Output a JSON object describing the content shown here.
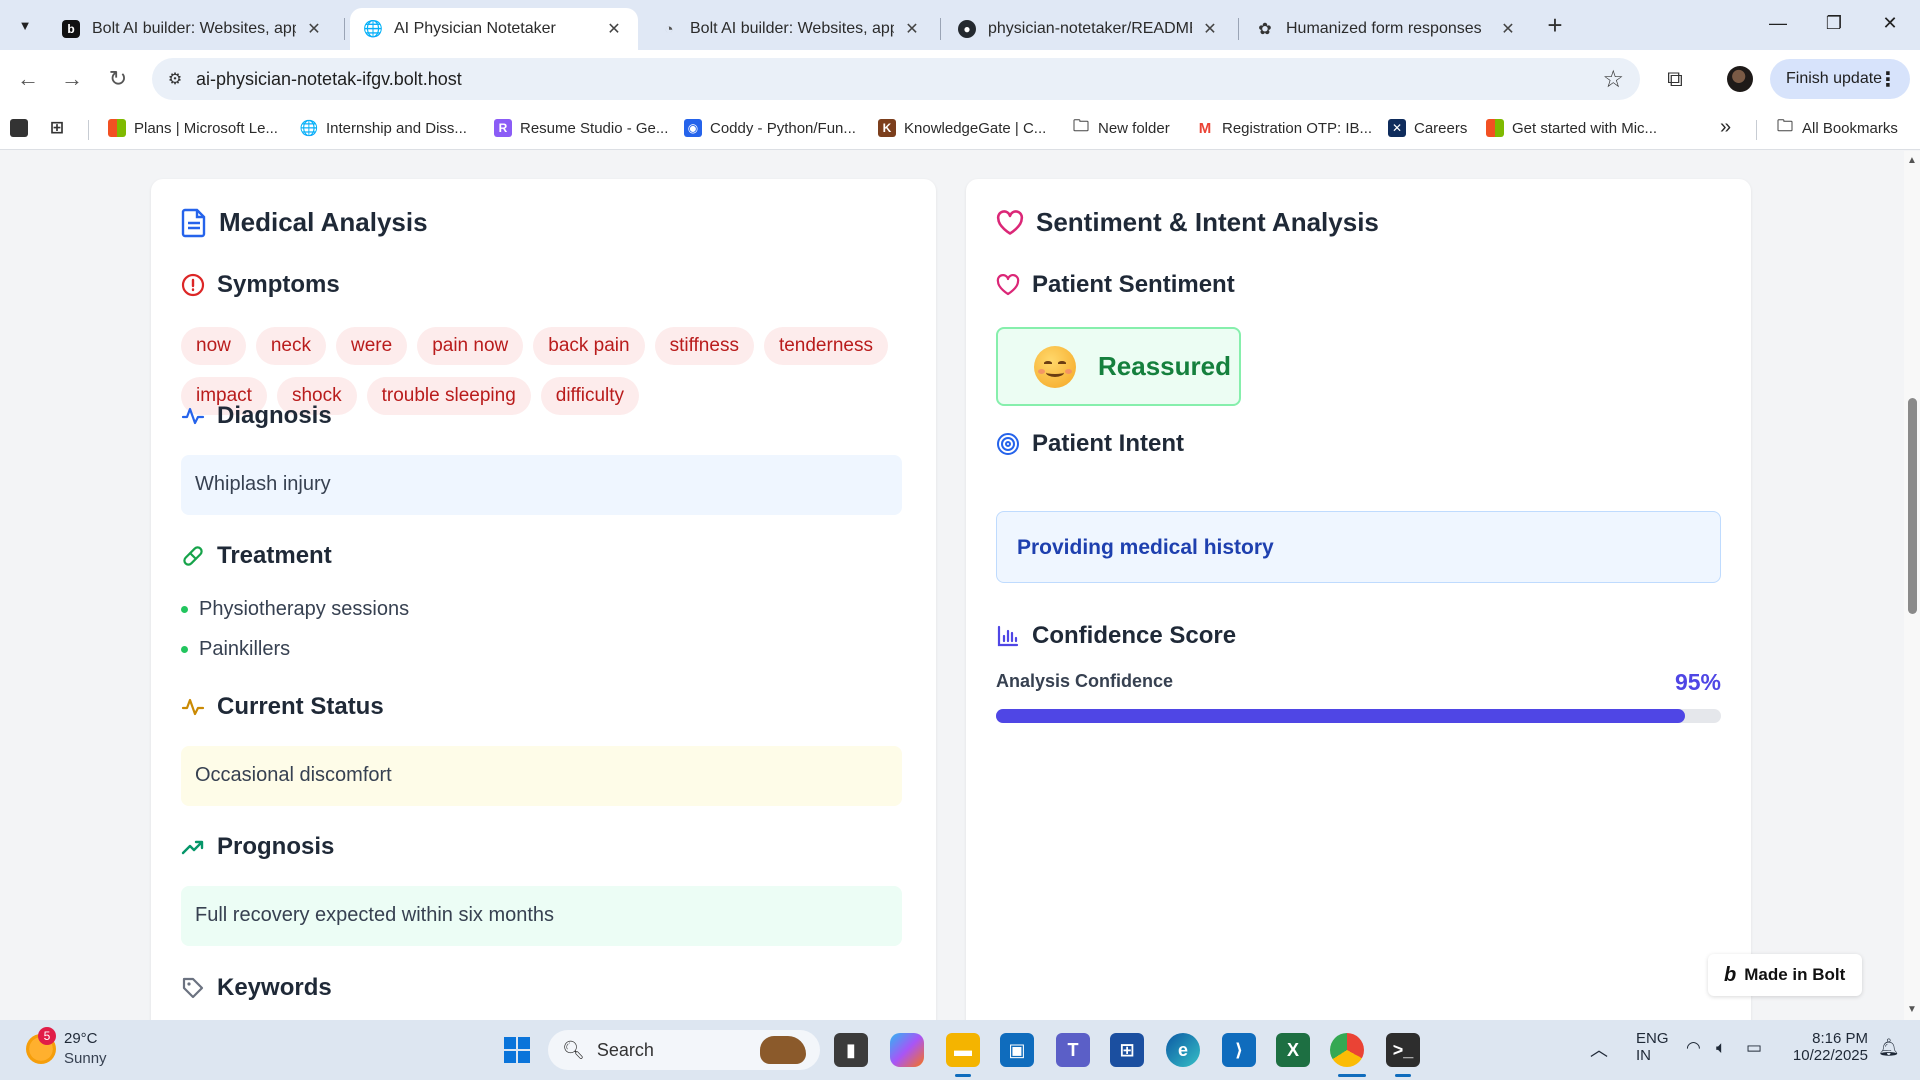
{
  "browser": {
    "tabs": [
      {
        "title": "Bolt AI builder: Websites, apps &",
        "active": false
      },
      {
        "title": "AI Physician Notetaker",
        "active": true
      },
      {
        "title": "Bolt AI builder: Websites, apps &",
        "active": false
      },
      {
        "title": "physician-notetaker/README.m",
        "active": false
      },
      {
        "title": "Humanized form responses",
        "active": false
      }
    ],
    "url": "ai-physician-notetak-ifgv.bolt.host",
    "finish_update_label": "Finish update",
    "bookmarks": [
      "Plans | Microsoft Le...",
      "Internship and Diss...",
      "Resume Studio - Ge...",
      "Coddy - Python/Fun...",
      "KnowledgeGate | C...",
      "New folder",
      "Registration OTP: IB...",
      "Careers",
      "Get started with Mic..."
    ],
    "all_bookmarks_label": "All Bookmarks",
    "more_bookmarks": "»"
  },
  "medical": {
    "title": "Medical Analysis",
    "symptoms_heading": "Symptoms",
    "symptoms": [
      "now",
      "neck",
      "were",
      "pain now",
      "back pain",
      "stiffness",
      "tenderness",
      "impact",
      "shock",
      "trouble sleeping",
      "difficulty"
    ],
    "diagnosis_heading": "Diagnosis",
    "diagnosis": "Whiplash injury",
    "treatment_heading": "Treatment",
    "treatments": [
      "Physiotherapy sessions",
      "Painkillers"
    ],
    "status_heading": "Current Status",
    "status": "Occasional discomfort",
    "prognosis_heading": "Prognosis",
    "prognosis": "Full recovery expected within six months",
    "keywords_heading": "Keywords"
  },
  "sentiment": {
    "title": "Sentiment & Intent Analysis",
    "patient_sentiment_heading": "Patient Sentiment",
    "sentiment_value": "Reassured",
    "patient_intent_heading": "Patient Intent",
    "intent_value": "Providing medical history",
    "confidence_heading": "Confidence Score",
    "confidence_label": "Analysis Confidence",
    "confidence_text": "95%",
    "confidence_fraction": 0.95
  },
  "badge": {
    "made_in_bolt": "Made in Bolt"
  },
  "taskbar": {
    "weather_badge": "5",
    "temperature": "29°C",
    "weather": "Sunny",
    "search_placeholder": "Search",
    "lang_1": "ENG",
    "lang_2": "IN",
    "time": "8:16 PM",
    "date": "10/22/2025"
  },
  "colors": {
    "accent": "#4f46e5",
    "chip_bg": "#fdecec",
    "chip_text": "#b91c1c",
    "sentiment_green": "#15803d",
    "intent_blue": "#1e40af"
  }
}
